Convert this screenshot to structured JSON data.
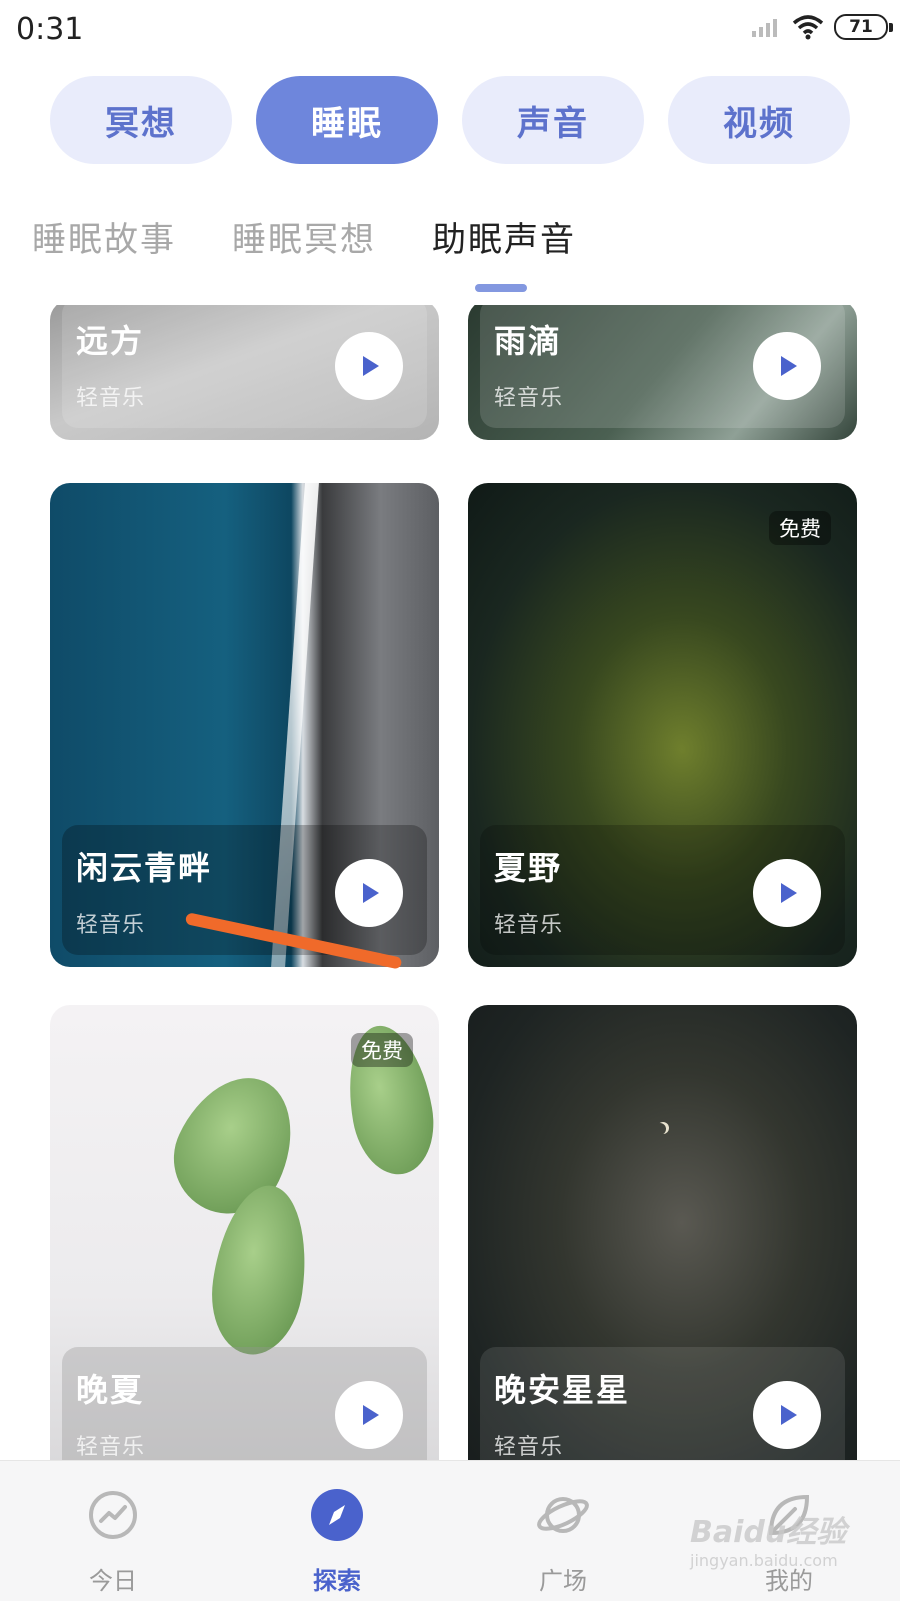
{
  "status_bar": {
    "time": "0:31",
    "battery": "71"
  },
  "categories": [
    {
      "label": "冥想",
      "active": false
    },
    {
      "label": "睡眠",
      "active": true
    },
    {
      "label": "声音",
      "active": false
    },
    {
      "label": "视频",
      "active": false
    }
  ],
  "sub_tabs": [
    {
      "label": "睡眠故事",
      "active": false
    },
    {
      "label": "睡眠冥想",
      "active": false
    },
    {
      "label": "助眠声音",
      "active": true
    }
  ],
  "cards": [
    {
      "title": "远方",
      "subtitle": "轻音乐"
    },
    {
      "title": "雨滴",
      "subtitle": "轻音乐"
    },
    {
      "title": "闲云青畔",
      "subtitle": "轻音乐"
    },
    {
      "title": "夏野",
      "subtitle": "轻音乐",
      "badge": "免费"
    },
    {
      "title": "晚夏",
      "subtitle": "轻音乐",
      "badge": "免费"
    },
    {
      "title": "晚安星星",
      "subtitle": "轻音乐"
    }
  ],
  "bottom_nav": [
    {
      "label": "今日",
      "icon": "trend-icon",
      "active": false
    },
    {
      "label": "探索",
      "icon": "compass-icon",
      "active": true
    },
    {
      "label": "广场",
      "icon": "planet-icon",
      "active": false
    },
    {
      "label": "我的",
      "icon": "leaf-icon",
      "active": false
    }
  ],
  "watermark": {
    "text": "Baidu经验",
    "sub": "jingyan.baidu.com"
  },
  "colors": {
    "accent": "#6e86dc",
    "pill_bg": "#e9ecfb",
    "nav_active": "#4a62cc",
    "annotation": "#f06a2a"
  }
}
